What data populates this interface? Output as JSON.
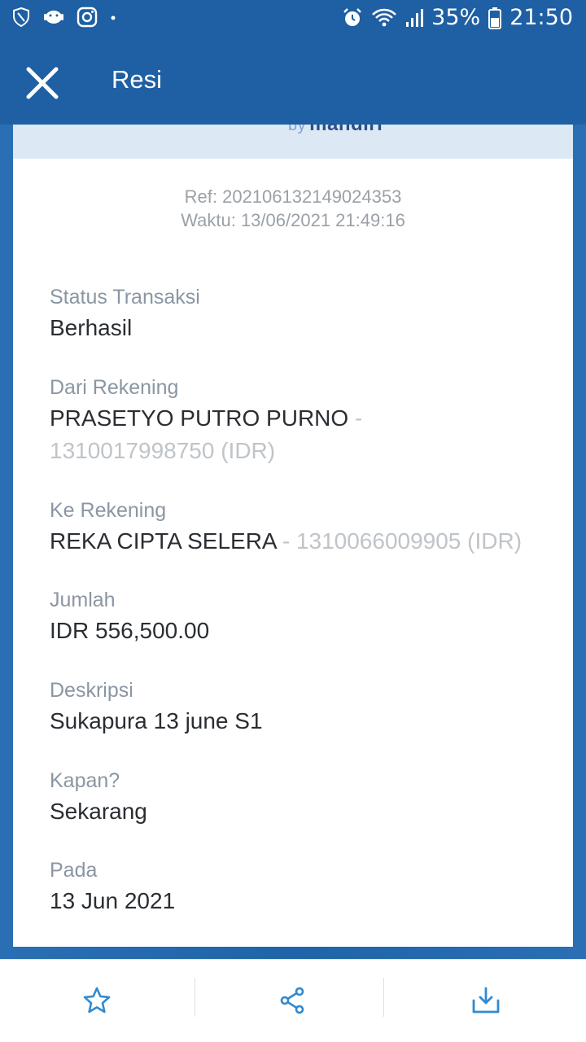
{
  "status_bar": {
    "battery": "35%",
    "time": "21:50",
    "icons_left": [
      "shield-icon",
      "android-icon",
      "instagram-icon",
      "dot-icon"
    ],
    "icons_right": [
      "alarm-icon",
      "wifi-icon",
      "signal-icon",
      "battery-icon"
    ]
  },
  "app_bar": {
    "title": "Resi",
    "close_icon": "close-icon"
  },
  "card": {
    "logo_by": "by",
    "logo_name": "mandiri",
    "ref": "Ref: 202106132149024353",
    "time": "Waktu: 13/06/2021 21:49:16",
    "fields": {
      "status": {
        "label": "Status Transaksi",
        "value": "Berhasil"
      },
      "from": {
        "label": "Dari Rekening",
        "name": "PRASETYO PUTRO PURNO",
        "sep": " - ",
        "account": "1310017998750 (IDR)"
      },
      "to": {
        "label": "Ke Rekening",
        "name": "REKA CIPTA SELERA",
        "sep": " - ",
        "account": "1310066009905 (IDR)"
      },
      "amount": {
        "label": "Jumlah",
        "value": "IDR 556,500.00"
      },
      "desc": {
        "label": "Deskripsi",
        "value": "Sukapura 13 june S1"
      },
      "when": {
        "label": "Kapan?",
        "value": "Sekarang"
      },
      "on": {
        "label": "Pada",
        "value": "13 Jun 2021"
      }
    }
  },
  "bottom_bar": {
    "accent": "#2f8ad2",
    "actions": [
      "star-icon",
      "share-icon",
      "download-icon"
    ]
  }
}
